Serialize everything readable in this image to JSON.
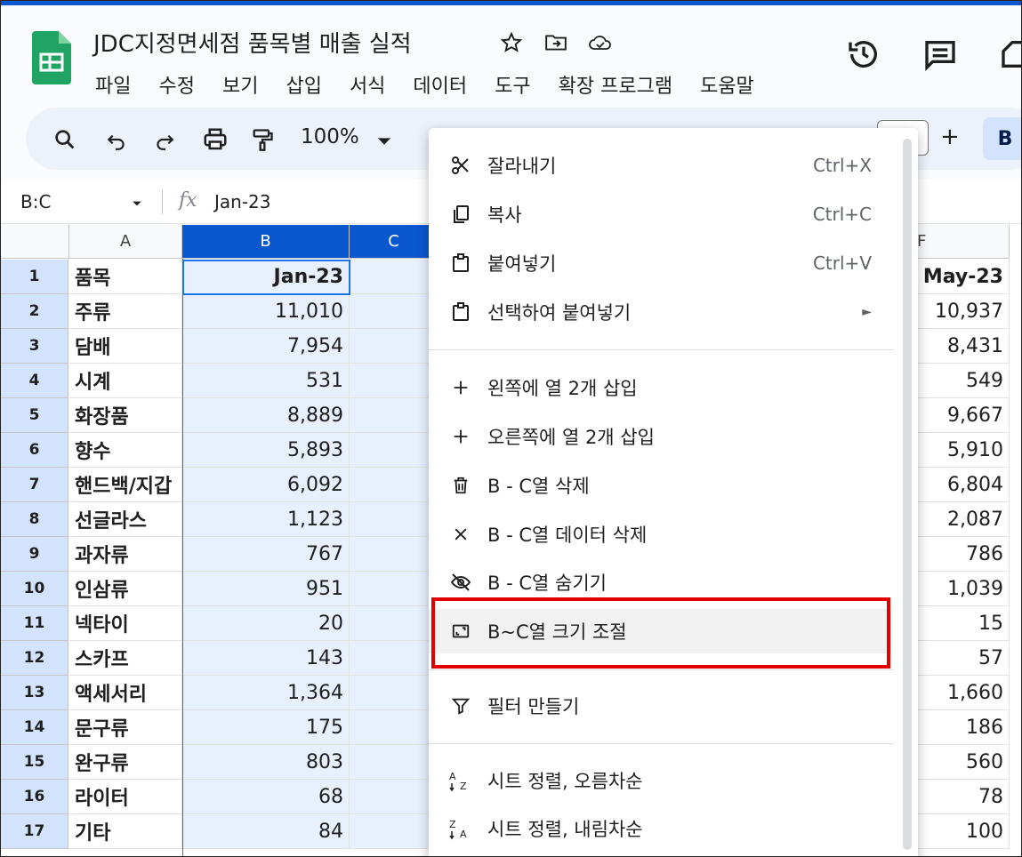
{
  "document": {
    "title": "JDC지정면세점 품목별 매출 실적",
    "menus": [
      "파일",
      "수정",
      "보기",
      "삽입",
      "서식",
      "데이터",
      "도구",
      "확장 프로그램",
      "도움말"
    ]
  },
  "toolbar": {
    "zoom": "100%",
    "bold_label": "B"
  },
  "formula_bar": {
    "name_box": "B:C",
    "fx_label": "fx",
    "value": "Jan-23"
  },
  "columns": {
    "a": "A",
    "b": "B",
    "c": "C",
    "f": "F"
  },
  "rows": [
    {
      "n": "1",
      "item": "품목",
      "jan": "Jan-23",
      "may": "May-23"
    },
    {
      "n": "2",
      "item": "주류",
      "jan": "11,010",
      "may": "10,937"
    },
    {
      "n": "3",
      "item": "담배",
      "jan": "7,954",
      "may": "8,431"
    },
    {
      "n": "4",
      "item": "시계",
      "jan": "531",
      "may": "549"
    },
    {
      "n": "5",
      "item": "화장품",
      "jan": "8,889",
      "may": "9,667"
    },
    {
      "n": "6",
      "item": "향수",
      "jan": "5,893",
      "may": "5,910"
    },
    {
      "n": "7",
      "item": "핸드백/지갑",
      "jan": "6,092",
      "may": "6,804"
    },
    {
      "n": "8",
      "item": "선글라스",
      "jan": "1,123",
      "may": "2,087"
    },
    {
      "n": "9",
      "item": "과자류",
      "jan": "767",
      "may": "786"
    },
    {
      "n": "10",
      "item": "인삼류",
      "jan": "951",
      "may": "1,039"
    },
    {
      "n": "11",
      "item": "넥타이",
      "jan": "20",
      "may": "15"
    },
    {
      "n": "12",
      "item": "스카프",
      "jan": "143",
      "may": "57"
    },
    {
      "n": "13",
      "item": "액세서리",
      "jan": "1,364",
      "may": "1,660"
    },
    {
      "n": "14",
      "item": "문구류",
      "jan": "175",
      "may": "186"
    },
    {
      "n": "15",
      "item": "완구류",
      "jan": "803",
      "may": "560"
    },
    {
      "n": "16",
      "item": "라이터",
      "jan": "68",
      "may": "78"
    },
    {
      "n": "17",
      "item": "기타",
      "jan": "84",
      "may": "100"
    }
  ],
  "context_menu": {
    "cut": {
      "label": "잘라내기",
      "shortcut": "Ctrl+X"
    },
    "copy": {
      "label": "복사",
      "shortcut": "Ctrl+C"
    },
    "paste": {
      "label": "붙여넣기",
      "shortcut": "Ctrl+V"
    },
    "paste_special": {
      "label": "선택하여 붙여넣기",
      "arrow": "►"
    },
    "insert_left": {
      "label": "왼쪽에 열 2개 삽입"
    },
    "insert_right": {
      "label": "오른쪽에 열 2개 삽입"
    },
    "delete_cols": {
      "label": "B - C열 삭제"
    },
    "clear_cols": {
      "label": "B - C열 데이터 삭제"
    },
    "hide_cols": {
      "label": "B - C열 숨기기"
    },
    "resize_cols": {
      "label": "B~C열 크기 조절"
    },
    "create_filter": {
      "label": "필터 만들기"
    },
    "sort_asc": {
      "label": "시트 정렬, 오름차순"
    },
    "sort_desc": {
      "label": "시트 정렬, 내림차순"
    }
  },
  "colors": {
    "accent": "#0b57d0",
    "highlight": "#e00000",
    "selection": "#e8f0fe"
  }
}
